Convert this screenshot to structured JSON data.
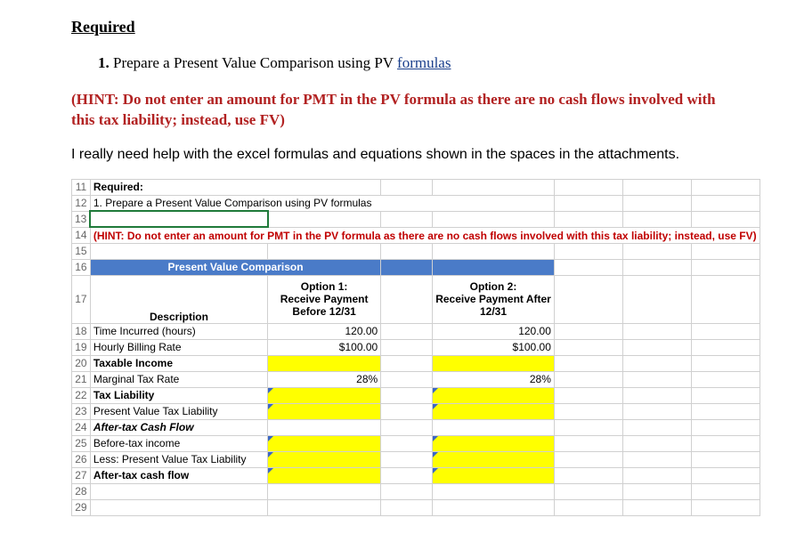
{
  "heading": "Required",
  "item1_num": "1.",
  "item1_text_before": "Prepare a Present Value Comparison using PV ",
  "item1_link": "formulas",
  "hint_main": "(HINT: Do not enter an amount for PMT in the PV formula as there are no cash flows involved with this tax liability; instead, use FV)",
  "help_text": "I really need help with the excel formulas and equations shown in the spaces in the attachments.",
  "rows": {
    "r11": "11",
    "r12": "12",
    "r13": "13",
    "r14": "14",
    "r15": "15",
    "r16": "16",
    "r17": "17",
    "r18": "18",
    "r19": "19",
    "r20": "20",
    "r21": "21",
    "r22": "22",
    "r23": "23",
    "r24": "24",
    "r25": "25",
    "r26": "26",
    "r27": "27",
    "r28": "28",
    "r29": "29"
  },
  "sheet": {
    "required_label": "Required:",
    "task": "1. Prepare a Present Value Comparison using PV formulas",
    "hint_inner": "(HINT: Do not enter an amount for PMT in the PV formula as there are no cash flows involved with this tax liability; instead, use FV)",
    "pv_title": "Present Value Comparison",
    "opt1_l1": "Option 1:",
    "opt1_l2": "Receive Payment",
    "opt1_l3": "Before 12/31",
    "opt2_l1": "Option 2:",
    "opt2_l2": "Receive Payment After",
    "opt2_l3": "12/31",
    "desc_hdr": "Description",
    "r18_label": "Time Incurred (hours)",
    "r18_o1": "120.00",
    "r18_o2": "120.00",
    "r19_label": "Hourly Billing Rate",
    "r19_o1": "$100.00",
    "r19_o2": "$100.00",
    "r20_label": "Taxable Income",
    "r21_label": "Marginal Tax Rate",
    "r21_o1": "28%",
    "r21_o2": "28%",
    "r22_label": "Tax Liability",
    "r23_label": "Present Value Tax Liability",
    "r24_label": "After-tax Cash Flow",
    "r25_label": "Before-tax income",
    "r26_label": "Less: Present Value Tax Liability",
    "r27_label": "After-tax cash flow"
  }
}
